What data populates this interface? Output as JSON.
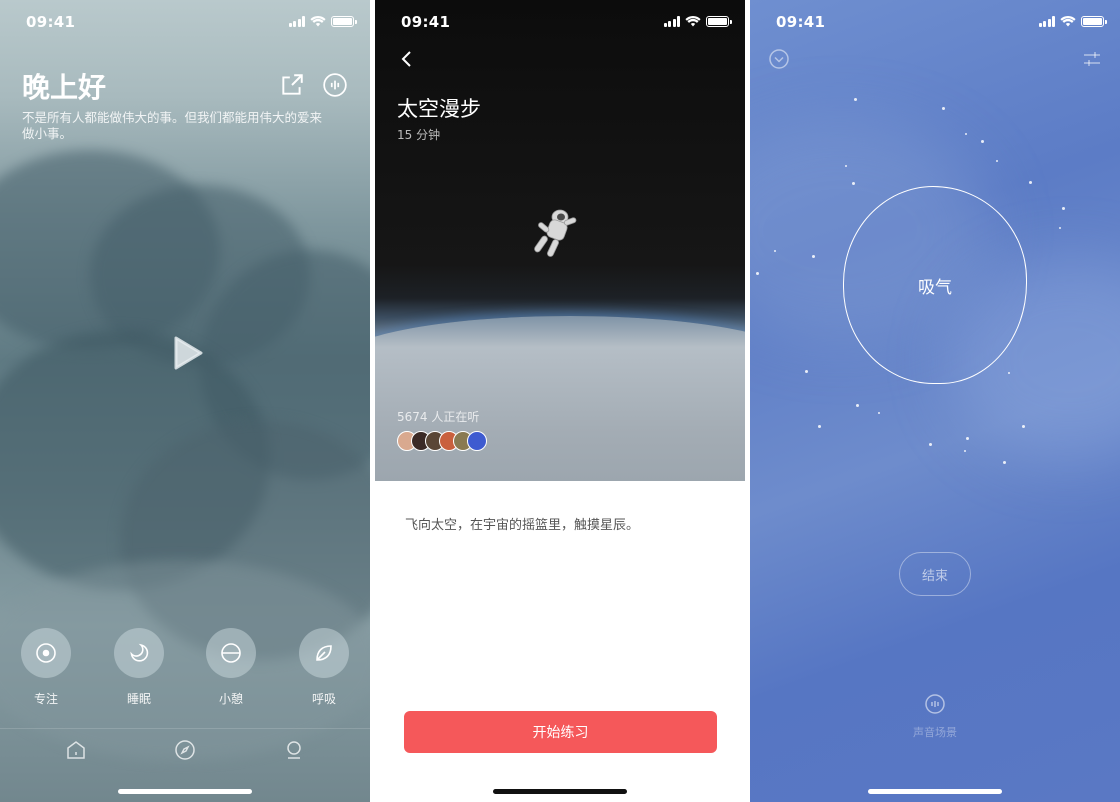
{
  "status": {
    "time": "09:41"
  },
  "screen1": {
    "greeting": "晚上好",
    "quote": "不是所有人都能做伟大的事。但我们都能用伟大的爱来做小事。",
    "modes": [
      {
        "label": "专注",
        "icon": "target-icon"
      },
      {
        "label": "睡眠",
        "icon": "moon-icon"
      },
      {
        "label": "小憩",
        "icon": "half-circle-icon"
      },
      {
        "label": "呼吸",
        "icon": "leaf-icon"
      }
    ],
    "tabs": [
      "home-icon",
      "compass-icon",
      "profile-icon"
    ]
  },
  "screen2": {
    "title": "太空漫步",
    "duration": "15 分钟",
    "listeners": "5674 人正在听",
    "description": "飞向太空，在宇宙的摇篮里，触摸星辰。",
    "start_label": "开始练习",
    "avatar_colors": [
      "#d9a98f",
      "#3b2a26",
      "#5a4636",
      "#c9603e",
      "#8a7a52",
      "#3e5bd0"
    ]
  },
  "screen3": {
    "breath_label": "吸气",
    "end_label": "结束",
    "sound_label": "声音场景"
  }
}
